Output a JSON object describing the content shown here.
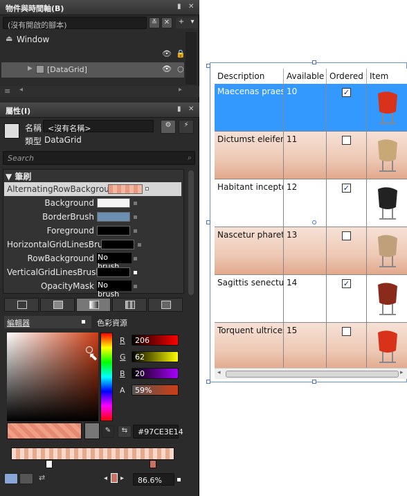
{
  "objects_panel": {
    "title": "物件與時間軸(B)",
    "script_input": "(沒有開啟的腳本)",
    "tree": [
      {
        "label": "Window"
      },
      {
        "label": "[DataGrid]"
      }
    ]
  },
  "properties_panel": {
    "title": "屬性(I)",
    "name_label": "名稱",
    "name_value": "<沒有名稱>",
    "type_label": "類型",
    "type_value": "DataGrid",
    "search_placeholder": "Search",
    "brush_section": "筆刷",
    "brushes": [
      {
        "label": "AlternatingRowBackground",
        "value": ""
      },
      {
        "label": "Background",
        "value": ""
      },
      {
        "label": "BorderBrush",
        "value": ""
      },
      {
        "label": "Foreground",
        "value": ""
      },
      {
        "label": "HorizontalGridLinesBrush",
        "value": ""
      },
      {
        "label": "RowBackground",
        "value": "No brush"
      },
      {
        "label": "VerticalGridLinesBrush",
        "value": ""
      },
      {
        "label": "OpacityMask",
        "value": "No brush"
      }
    ],
    "tabs": {
      "editor": "編輯器",
      "color_resources": "色彩資源"
    },
    "channels": [
      {
        "name": "R",
        "value": "206"
      },
      {
        "name": "G",
        "value": "62"
      },
      {
        "name": "B",
        "value": "20"
      },
      {
        "name": "A",
        "value": "59%"
      }
    ],
    "hex": "#97CE3E14",
    "gradient_stop_offset": "86.6%"
  },
  "colors": {
    "selected_row": "#3399ff",
    "alt_row": "#edc8b4",
    "border_brush": "#6b8fb0",
    "accent": "#ce3e14"
  },
  "datagrid": {
    "columns": [
      "Description",
      "Available",
      "Ordered",
      "Item"
    ],
    "rows": [
      {
        "description": "Maecenas praesent",
        "available": "10",
        "ordered": true,
        "item": "chair-icon",
        "selected": true
      },
      {
        "description": "Dictumst eleifend",
        "available": "11",
        "ordered": false,
        "item": "chair-icon"
      },
      {
        "description": "Habitant inceptos",
        "available": "12",
        "ordered": true,
        "item": "chair-icon"
      },
      {
        "description": "Nascetur pharetra",
        "available": "13",
        "ordered": false,
        "item": "chair-icon"
      },
      {
        "description": "Sagittis senectus",
        "available": "14",
        "ordered": true,
        "item": "chair-icon"
      },
      {
        "description": "Torquent ultrices",
        "available": "15",
        "ordered": false,
        "item": "chair-icon"
      }
    ]
  }
}
